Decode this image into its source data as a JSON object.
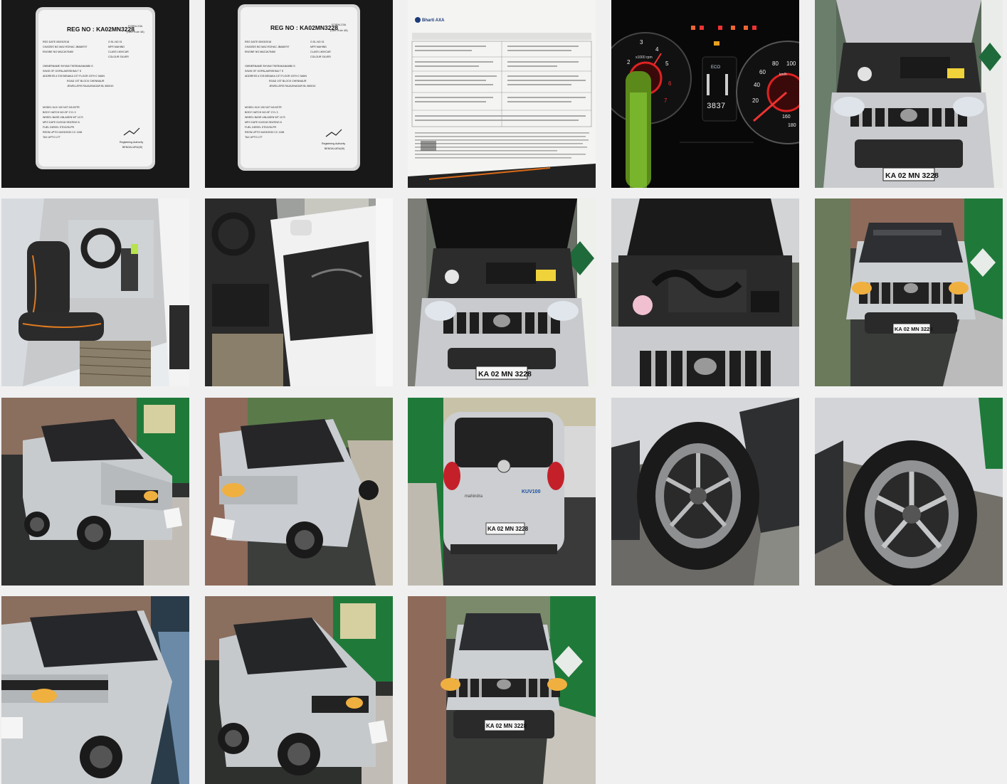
{
  "gallery": {
    "photos": [
      {
        "label": "RC card front"
      },
      {
        "label": "RC card copy"
      },
      {
        "label": "Insurance document"
      },
      {
        "label": "Instrument cluster"
      },
      {
        "label": "Engine bay front"
      },
      {
        "label": "Driver seat interior"
      },
      {
        "label": "Driver door interior"
      },
      {
        "label": "Engine bay open"
      },
      {
        "label": "Engine close-up"
      },
      {
        "label": "Front view"
      },
      {
        "label": "Front left three-quarter"
      },
      {
        "label": "Front left angle"
      },
      {
        "label": "Rear view"
      },
      {
        "label": "Front wheel"
      },
      {
        "label": "Rear wheel"
      },
      {
        "label": "Front angle close"
      },
      {
        "label": "Left side three-quarter"
      },
      {
        "label": "Front view street"
      }
    ]
  },
  "rc_card": {
    "title": "REG NO : KA02MN3228",
    "form": "FORM-23A",
    "rule": "(See Rule 48)",
    "fields_left": [
      "REG DATE   05/03/2018",
      "CHASSIS NO  MA1YE2HAC JBA88797",
      "ENGINE NO   MAZJA75460"
    ],
    "fields_right": [
      "O.SL.NO   01",
      "MFR    MAHIND",
      "CLASS   LMV/CAR",
      "COLOUR  SILVER"
    ],
    "owner": [
      "OWNERNAME  SHYAM THERAKANAMBI G",
      "S/W/D OF    GOPALAKRISHNA T S",
      "ADDRESS   # 378 BENAKA 1ST FLOOR 15TH C MAIN",
      "ROAD 1ST BLOCK CHENNAUR",
      "JEWELLERS RAJAJINAGAR BL 560010"
    ],
    "specs": [
      "MODEL   KUV 100 NXT K8 6STR",
      "BODY    HATCH     NO.OF CYL  3",
      "WHEEL BASE     UNLADEN WT  1170",
      "MFG DATE  01/2018   SEATING  6",
      "FUEL    DIESEL    STDG/SLPR",
      "REGN UPTO  04/03/2033   CC   1198",
      "TAX UPTO   LTT"
    ],
    "authority": "Registering Authority",
    "city": "BENGALURU(W)"
  },
  "cluster": {
    "odometer": "3837",
    "eco": "ECO",
    "rpm_label": "x1000 rpm",
    "speed_unit": "km/h",
    "rpm_ticks": [
      "1",
      "2",
      "3",
      "4",
      "5",
      "6",
      "7"
    ],
    "speed_ticks": [
      "20",
      "40",
      "60",
      "80",
      "100",
      "160",
      "180"
    ]
  },
  "vehicle": {
    "plate": "KA 02 MN 3228",
    "badge_model": "KUV100",
    "badge_brand": "mahindra",
    "doc_brand": "Bharti AXA"
  }
}
